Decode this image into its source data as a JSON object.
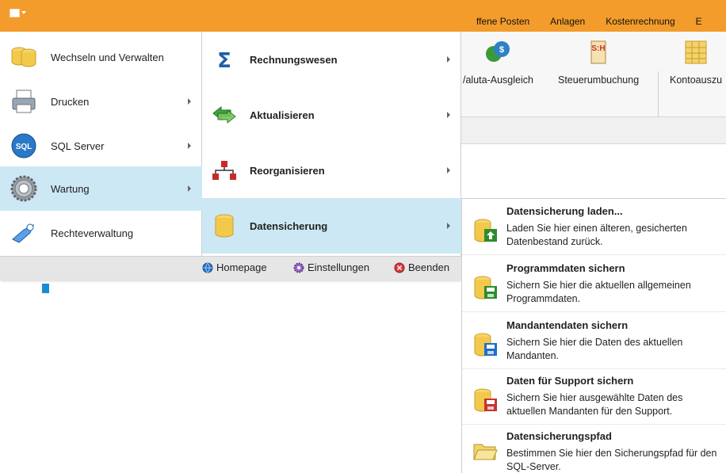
{
  "ribbon_tabs": [
    "ffene Posten",
    "Anlagen",
    "Kostenrechnung",
    "E"
  ],
  "ribbon_items": [
    "/aluta-Ausgleich",
    "Steuerumbuchung",
    "Kontoauszu"
  ],
  "menu1": [
    {
      "label": "Wechseln und Verwalten",
      "icon": "database-stack-icon",
      "has_arrow": false
    },
    {
      "label": "Drucken",
      "icon": "printer-icon",
      "has_arrow": true
    },
    {
      "label": "SQL Server",
      "icon": "sql-server-icon",
      "has_arrow": true
    },
    {
      "label": "Wartung",
      "icon": "gear-icon",
      "has_arrow": true,
      "active": true
    },
    {
      "label": "Rechteverwaltung",
      "icon": "key-icon",
      "has_arrow": false
    }
  ],
  "menu2": [
    {
      "label": "Rechnungswesen",
      "icon": "sigma-icon"
    },
    {
      "label": "Aktualisieren",
      "icon": "refresh-arrows-icon"
    },
    {
      "label": "Reorganisieren",
      "icon": "hierarchy-icon"
    },
    {
      "label": "Datensicherung",
      "icon": "database-icon",
      "active": true
    }
  ],
  "bottom_bar": {
    "homepage": "Homepage",
    "settings": "Einstellungen",
    "exit": "Beenden"
  },
  "menu3": [
    {
      "title": "Datensicherung laden...",
      "desc": "Laden Sie hier einen älteren, gesicherten Datenbestand zurück.",
      "icon": "database-upload-icon",
      "accent": "#2e8b2e"
    },
    {
      "title": "Programmdaten sichern",
      "desc": "Sichern Sie hier die aktuellen allgemeinen Programmdaten.",
      "icon": "database-save-green-icon",
      "accent": "#2e8b2e"
    },
    {
      "title": "Mandantendaten sichern",
      "desc": "Sichern Sie hier die Daten des aktuellen Mandanten.",
      "icon": "database-save-blue-icon",
      "accent": "#1e6fc9"
    },
    {
      "title": "Daten für Support sichern",
      "desc": "Sichern Sie hier ausgewählte Daten des aktuellen Mandanten für den Support.",
      "icon": "database-save-red-icon",
      "accent": "#c83232"
    },
    {
      "title": "Datensicherungspfad",
      "desc": "Bestimmen Sie hier den Sicherungspfad für den SQL-Server.",
      "icon": "folder-open-icon",
      "accent": "#e8c14a"
    }
  ]
}
